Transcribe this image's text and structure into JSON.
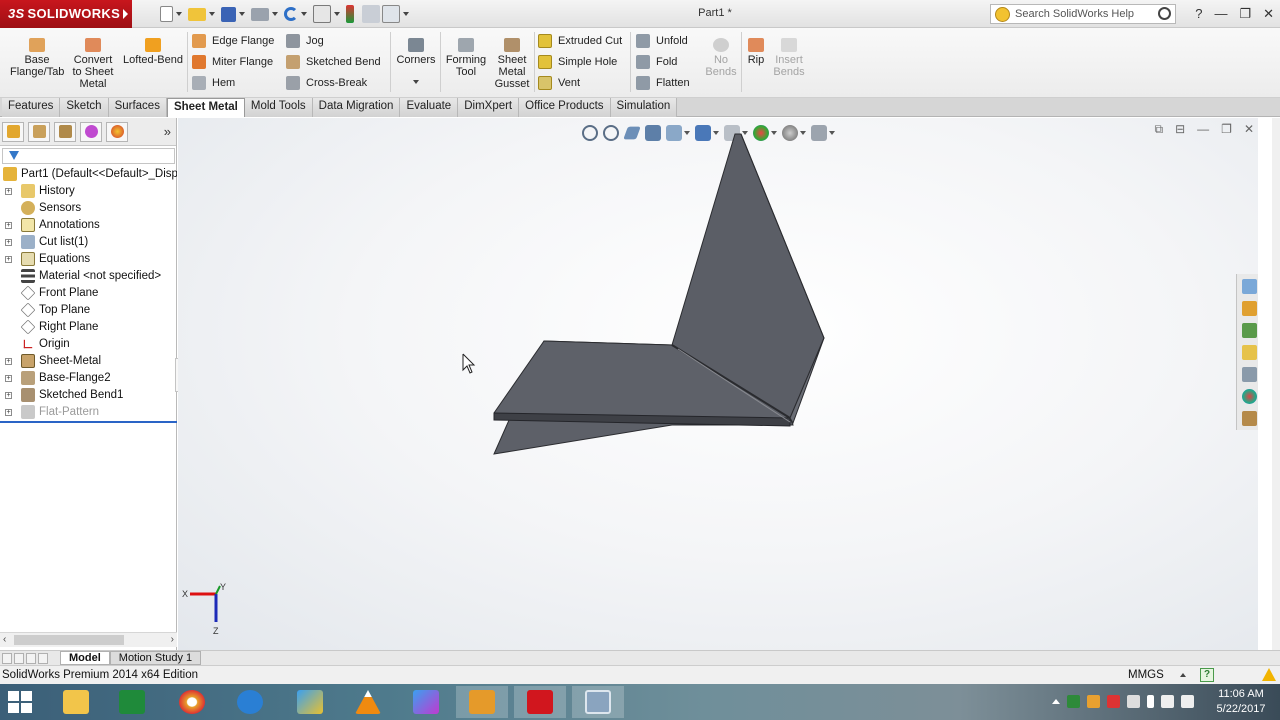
{
  "app": {
    "brand": "SOLIDWORKS",
    "document_title": "Part1 *",
    "search_placeholder": "Search SolidWorks Help",
    "window_controls": [
      "?",
      "—",
      "❐",
      "✕"
    ]
  },
  "ribbon": {
    "big_buttons": [
      {
        "label": "Base\nFlange/Tab",
        "icon": "base-flange-icon"
      },
      {
        "label": "Convert\nto Sheet\nMetal",
        "icon": "convert-sheet-metal-icon"
      },
      {
        "label": "Lofted-Bend",
        "icon": "lofted-bend-icon"
      },
      {
        "label": "Corners",
        "icon": "corners-icon"
      },
      {
        "label": "Forming\nTool",
        "icon": "forming-tool-icon"
      },
      {
        "label": "Sheet\nMetal\nGusset",
        "icon": "sheet-metal-gusset-icon"
      },
      {
        "label": "No\nBends",
        "icon": "no-bends-icon",
        "disabled": true
      },
      {
        "label": "Rip",
        "icon": "rip-icon"
      },
      {
        "label": "Insert\nBends",
        "icon": "insert-bends-icon",
        "disabled": true
      }
    ],
    "small_buttons": [
      {
        "label": "Edge Flange",
        "icon": "edge-flange-icon"
      },
      {
        "label": "Miter Flange",
        "icon": "miter-flange-icon"
      },
      {
        "label": "Hem",
        "icon": "hem-icon"
      },
      {
        "label": "Jog",
        "icon": "jog-icon"
      },
      {
        "label": "Sketched Bend",
        "icon": "sketched-bend-icon"
      },
      {
        "label": "Cross-Break",
        "icon": "cross-break-icon"
      },
      {
        "label": "Extruded Cut",
        "icon": "extruded-cut-icon"
      },
      {
        "label": "Simple Hole",
        "icon": "simple-hole-icon"
      },
      {
        "label": "Vent",
        "icon": "vent-icon"
      },
      {
        "label": "Unfold",
        "icon": "unfold-icon"
      },
      {
        "label": "Fold",
        "icon": "fold-icon"
      },
      {
        "label": "Flatten",
        "icon": "flatten-icon"
      }
    ]
  },
  "tabs": [
    "Features",
    "Sketch",
    "Surfaces",
    "Sheet Metal",
    "Mold Tools",
    "Data Migration",
    "Evaluate",
    "DimXpert",
    "Office Products",
    "Simulation"
  ],
  "active_tab": "Sheet Metal",
  "feature_tree": {
    "root": "Part1  (Default<<Default>_Disp",
    "nodes": [
      {
        "label": "History",
        "icon": "history-icon",
        "expandable": true
      },
      {
        "label": "Sensors",
        "icon": "sensors-icon",
        "expandable": false
      },
      {
        "label": "Annotations",
        "icon": "annotations-icon",
        "expandable": true
      },
      {
        "label": "Cut list(1)",
        "icon": "cut-list-icon",
        "expandable": true
      },
      {
        "label": "Equations",
        "icon": "equations-icon",
        "expandable": true
      },
      {
        "label": "Material <not specified>",
        "icon": "material-icon",
        "expandable": false
      },
      {
        "label": "Front Plane",
        "icon": "plane-icon",
        "expandable": false
      },
      {
        "label": "Top Plane",
        "icon": "plane-icon",
        "expandable": false
      },
      {
        "label": "Right Plane",
        "icon": "plane-icon",
        "expandable": false
      },
      {
        "label": "Origin",
        "icon": "origin-icon",
        "expandable": false
      },
      {
        "label": "Sheet-Metal",
        "icon": "sheet-metal-icon",
        "expandable": true
      },
      {
        "label": "Base-Flange2",
        "icon": "base-flange-feature-icon",
        "expandable": true
      },
      {
        "label": "Sketched Bend1",
        "icon": "sketched-bend-feature-icon",
        "expandable": true
      },
      {
        "label": "Flat-Pattern",
        "icon": "flat-pattern-icon",
        "expandable": true,
        "suppressed": true
      }
    ]
  },
  "triad": {
    "x": "X",
    "y": "Y",
    "z": "Z"
  },
  "bottom_tabs": [
    "Model",
    "Motion Study 1"
  ],
  "status": {
    "edition": "SolidWorks Premium 2014 x64 Edition",
    "units": "MMGS",
    "help": "?"
  },
  "taskbar": {
    "time": "11:06 AM",
    "date": "5/22/2017",
    "apps": [
      "file-explorer-icon",
      "excel-icon",
      "chrome-icon",
      "internet-explorer-icon",
      "media-player-icon",
      "vlc-icon",
      "app-icon",
      "camtasia-icon",
      "solidworks-icon",
      "window-app-icon"
    ]
  },
  "colors": {
    "brand_red": "#c8161d",
    "model_gray": "#5d6068",
    "rollback_blue": "#2a64c6"
  }
}
